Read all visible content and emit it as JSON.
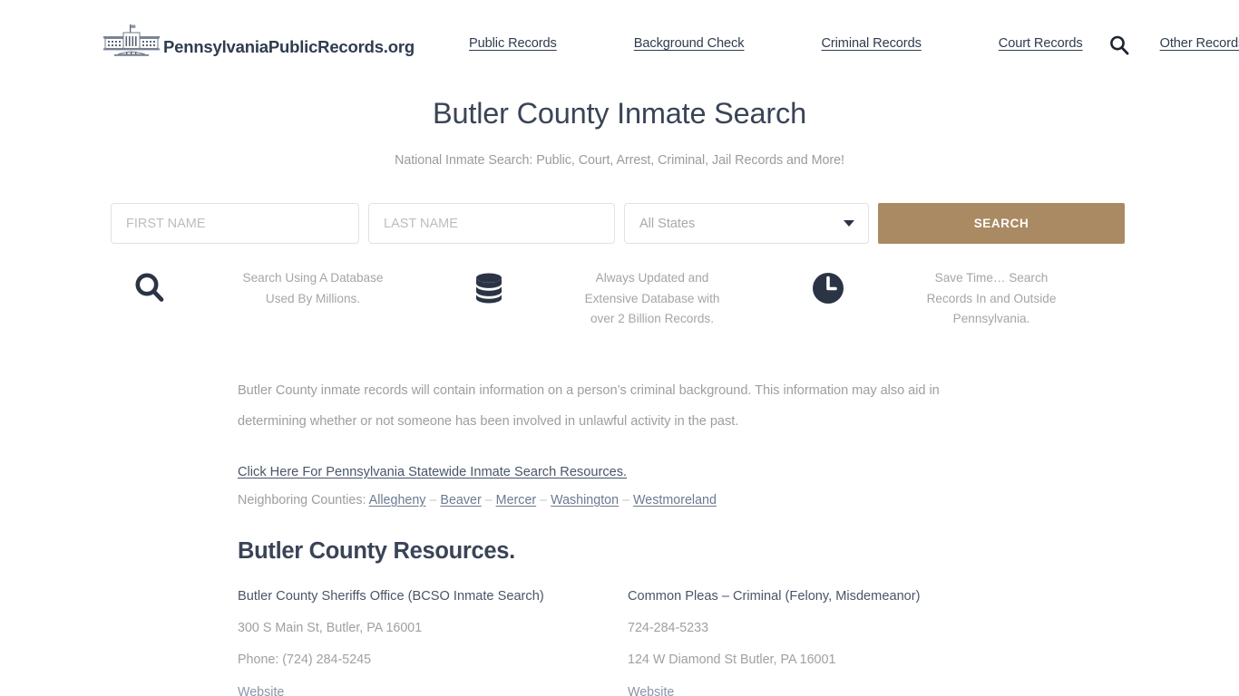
{
  "header": {
    "logo_text": "PennsylvaniaPublicRecords.org",
    "logo_icon": "white-house-building-icon",
    "search_icon": "search-icon",
    "nav": [
      {
        "label": "Public Records"
      },
      {
        "label": "Background Check"
      },
      {
        "label": "Criminal Records"
      },
      {
        "label": "Court Records"
      },
      {
        "label": "Other Records"
      }
    ]
  },
  "hero": {
    "title": "Butler County Inmate Search",
    "subtitle": "National Inmate Search: Public, Court, Arrest, Criminal, Jail Records and More!"
  },
  "search_form": {
    "first_name_placeholder": "FIRST NAME",
    "first_name_value": "",
    "last_name_placeholder": "LAST NAME",
    "last_name_value": "",
    "state_selected": "All States",
    "state_options": [
      "All States"
    ],
    "submit_label": "SEARCH",
    "button_color": "#a98a63",
    "caret_icon": "chevron-down-icon"
  },
  "features": [
    {
      "icon": "search-magnifier-icon",
      "line1": "Search Using A Database",
      "line2": "Used By Millions.",
      "line3": ""
    },
    {
      "icon": "database-icon",
      "line1": "Always Updated and",
      "line2": "Extensive Database with",
      "line3": "over 2 Billion Records."
    },
    {
      "icon": "clock-icon",
      "line1": "Save Time… Search",
      "line2": "Records In and Outside",
      "line3": "Pennsylvania."
    }
  ],
  "content": {
    "paragraph_line1": "Butler County inmate records will contain information on a person’s criminal background. This information may also aid in",
    "paragraph_line2": "determining whether or not someone has been involved in unlawful activity in the past.",
    "statewide_link": "Click Here For Pennsylvania Statewide Inmate Search Resources.",
    "neighbors_label": "Neighboring Counties:",
    "neighbors_separator": "–",
    "neighbors": [
      {
        "label": "Allegheny"
      },
      {
        "label": "Beaver"
      },
      {
        "label": "Mercer"
      },
      {
        "label": "Washington"
      },
      {
        "label": "Westmoreland"
      }
    ]
  },
  "resources": {
    "heading": "Butler County Resources.",
    "columns": [
      {
        "title": "Butler County Sheriffs Office (BCSO Inmate Search)",
        "line1": "300 S Main St, Butler, PA 16001",
        "line2": "Phone: (724) 284-5245",
        "website_label": "Website"
      },
      {
        "title": "Common Pleas – Criminal (Felony, Misdemeanor)",
        "line1": "724-284-5233",
        "line2": "124 W Diamond St Butler, PA 16001",
        "website_label": "Website"
      }
    ]
  }
}
